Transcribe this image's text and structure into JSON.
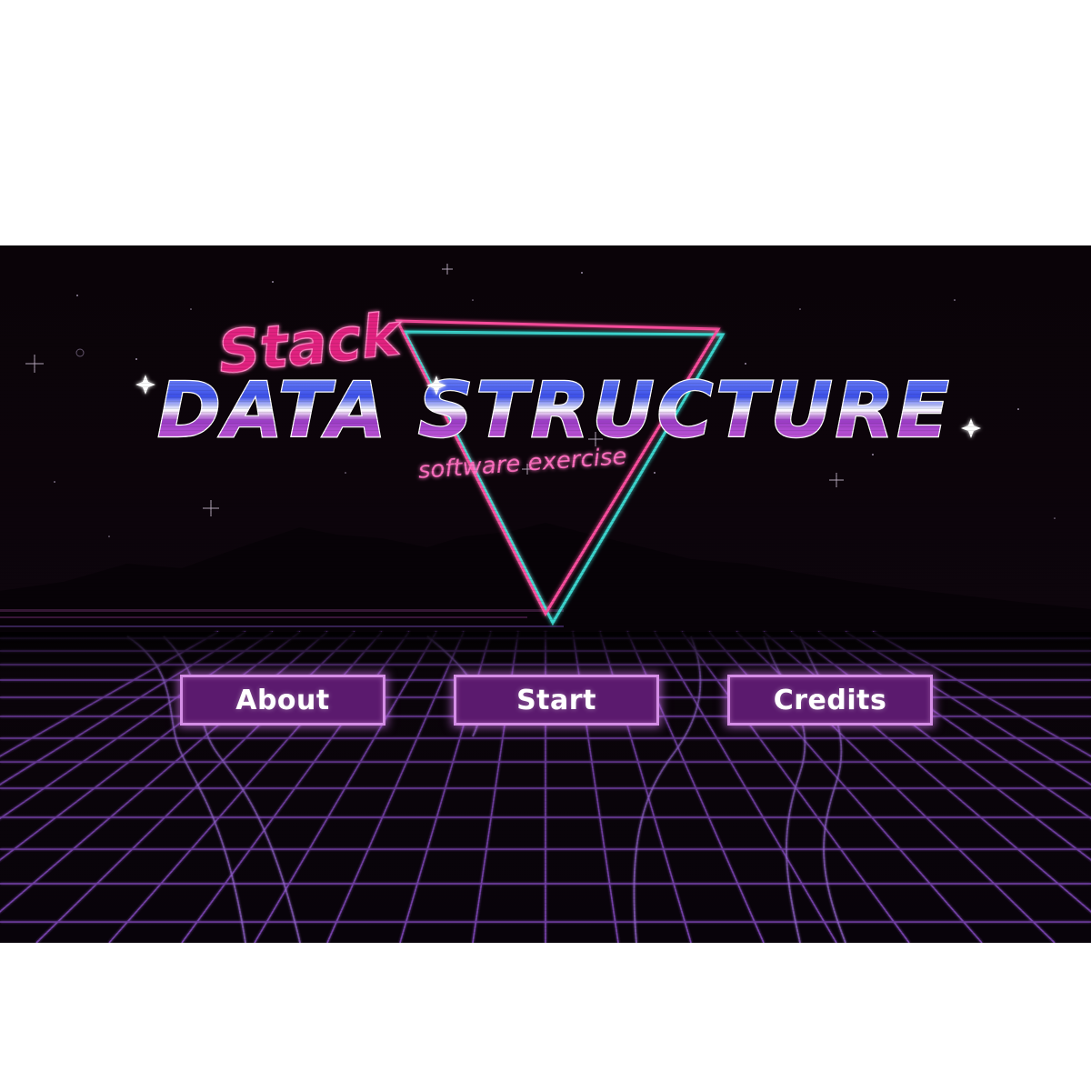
{
  "title": {
    "stack": "Stack",
    "main": "DATA STRUCTURE",
    "subtitle": "software exercise"
  },
  "menu": {
    "about_label": "About",
    "start_label": "Start",
    "credits_label": "Credits"
  },
  "colors": {
    "background": "#0a0308",
    "grid": "#8a4ec8",
    "stack_pink": "#e0227f",
    "subtitle_pink": "#ff6fc0",
    "title_top": "#4a6bff",
    "title_bottom": "#b03cc8",
    "triangle_pink": "#ff4fa0",
    "triangle_cyan": "#3fe0d8",
    "button_fill": "#5b1a6e",
    "button_border": "#d58ee6"
  },
  "icons": {
    "decoration": "neon-triangle-icon",
    "sparkles": "sparkle-icon"
  }
}
